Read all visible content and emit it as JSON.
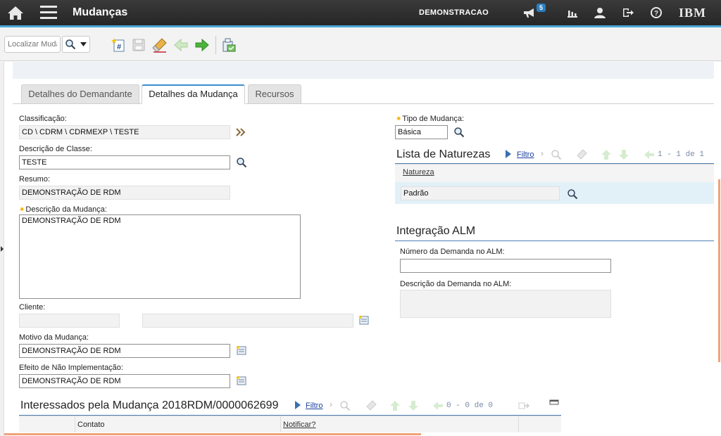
{
  "header": {
    "title": "Mudanças",
    "user": "DEMONSTRACAO",
    "notifications_count": "5",
    "brand": "IBM"
  },
  "toolbar": {
    "search_placeholder": "Localizar Muda",
    "actions": [
      "new-record",
      "save",
      "clear",
      "previous",
      "next",
      "apply-template"
    ]
  },
  "tabs": [
    {
      "label": "Detalhes do Demandante",
      "active": false
    },
    {
      "label": "Detalhes da Mudança",
      "active": true
    },
    {
      "label": "Recursos",
      "active": false
    }
  ],
  "form": {
    "classificacao": {
      "label": "Classificação:",
      "value": "CD \\ CDRM \\ CDRMEXP \\ TESTE"
    },
    "descricao_classe": {
      "label": "Descrição de Classe:",
      "value": "TESTE"
    },
    "resumo": {
      "label": "Resumo:",
      "value": "DEMONSTRAÇÃO DE RDM"
    },
    "descricao_mudanca": {
      "label": "Descrição da Mudança:",
      "value": "DEMONSTRAÇÃO DE RDM",
      "required": true
    },
    "cliente": {
      "label": "Cliente:",
      "value": "",
      "description": ""
    },
    "motivo": {
      "label": "Motivo da Mudança:",
      "value": "DEMONSTRAÇÃO DE RDM"
    },
    "efeito": {
      "label": "Efeito de Não Implementação:",
      "value": "DEMONSTRAÇÃO DE RDM"
    },
    "tipo_mudanca": {
      "label": "Tipo de Mudança:",
      "value": "Básica",
      "required": true
    }
  },
  "naturezas": {
    "title": "Lista de Naturezas",
    "filter_label": "Filtro",
    "pager": "1 - 1 de 1",
    "column": "Natureza",
    "rows": [
      "Padrão"
    ]
  },
  "alm": {
    "title": "Integração ALM",
    "numero_label": "Número da Demanda no ALM:",
    "numero_value": "",
    "descricao_label": "Descrição da Demanda no ALM:",
    "descricao_value": ""
  },
  "interessados": {
    "title": "Interessados pela Mudança 2018RDM/0000062699",
    "filter_label": "Filtro",
    "pager": "0 - 0 de 0",
    "columns": [
      "Contato",
      "Notificar?"
    ]
  },
  "colors": {
    "topbar": "#2e2e2e",
    "accent": "#4aa6d8",
    "link": "#1a3f9e",
    "section_rule": "#4f7fb3"
  }
}
